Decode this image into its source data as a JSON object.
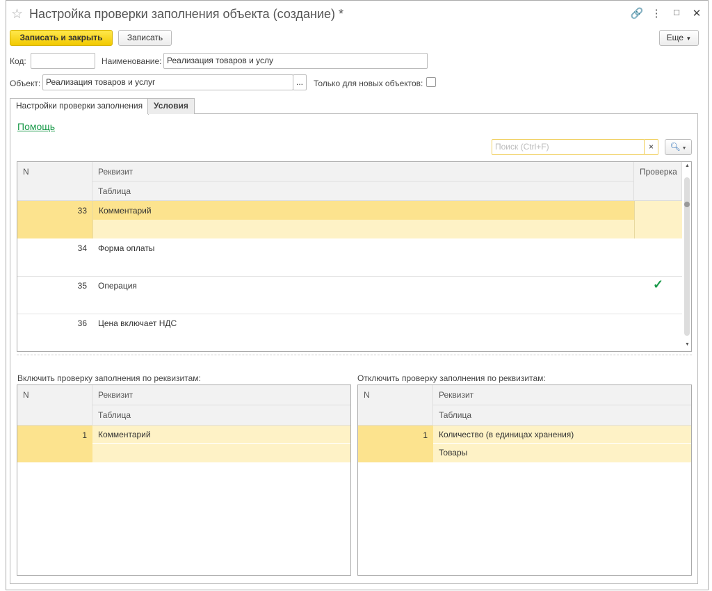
{
  "window": {
    "title": "Настройка проверки заполнения объекта (создание) *"
  },
  "toolbar": {
    "save_close": "Записать и закрыть",
    "save": "Записать",
    "more": "Еще"
  },
  "form": {
    "code_label": "Код:",
    "code_value": "",
    "name_label": "Наименование:",
    "name_value": "Реализация товаров и услу",
    "object_label": "Объект:",
    "object_value": "Реализация товаров и услуг",
    "select_btn": "...",
    "only_new_label": "Только для новых объектов:"
  },
  "tabs": [
    {
      "label": "Настройки проверки заполнения"
    },
    {
      "label": "Условия"
    }
  ],
  "help_link": "Помощь",
  "search": {
    "placeholder": "Поиск (Ctrl+F)",
    "clear": "×"
  },
  "main_table": {
    "headers": {
      "n": "N",
      "attr": "Реквизит",
      "table": "Таблица",
      "check": "Проверка"
    },
    "rows": [
      {
        "n": "33",
        "attr": "Комментарий",
        "table": "",
        "check": false,
        "selected": true
      },
      {
        "n": "34",
        "attr": "Форма оплаты",
        "table": "",
        "check": false
      },
      {
        "n": "35",
        "attr": "Операция",
        "table": "",
        "check": true,
        "check_mark": "✓"
      },
      {
        "n": "36",
        "attr": "Цена включает НДС",
        "table": "",
        "check": false
      }
    ]
  },
  "include_table": {
    "label": "Включить проверку заполнения по реквизитам:",
    "headers": {
      "n": "N",
      "attr": "Реквизит",
      "table": "Таблица"
    },
    "rows": [
      {
        "n": "1",
        "attr": "Комментарий",
        "table": ""
      }
    ]
  },
  "exclude_table": {
    "label": "Отключить проверку заполнения по реквизитам:",
    "headers": {
      "n": "N",
      "attr": "Реквизит",
      "table": "Таблица"
    },
    "rows": [
      {
        "n": "1",
        "attr": "Количество (в единицах хранения)",
        "table": "Товары"
      }
    ]
  }
}
